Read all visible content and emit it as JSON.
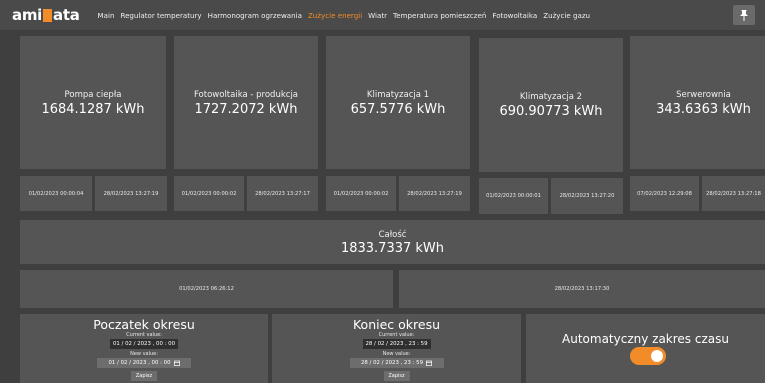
{
  "brand": {
    "logo_pre": "ami",
    "logo_post": "ata"
  },
  "nav": {
    "items": [
      {
        "label": "Main"
      },
      {
        "label": "Regulator temperatury"
      },
      {
        "label": "Harmonogram ogrzewania"
      },
      {
        "label": "Zużycie energii",
        "active": true
      },
      {
        "label": "Wiatr"
      },
      {
        "label": "Temperatura pomieszczeń"
      },
      {
        "label": "Fotowoltaika"
      },
      {
        "label": "Zużycie gazu"
      }
    ]
  },
  "cards": [
    {
      "title": "Pompa ciepła",
      "value": "1684.1287 kWh",
      "start": "01/02/2023 00:00:04",
      "end": "28/02/2023 13:27:19"
    },
    {
      "title": "Fotowoltaika - produkcja",
      "value": "1727.2072 kWh",
      "start": "01/02/2023 00:00:02",
      "end": "28/02/2023 13:27:17"
    },
    {
      "title": "Klimatyzacja 1",
      "value": "657.5776 kWh",
      "start": "01/02/2023 00:00:02",
      "end": "28/02/2023 13:27:19"
    },
    {
      "title": "Klimatyzacja 2",
      "value": "690.90773 kWh",
      "start": "01/02/2023 00:00:01",
      "end": "28/02/2023 13:27:20"
    },
    {
      "title": "Serwerownia",
      "value": "343.6363 kWh",
      "start": "07/02/2023 12:29:08",
      "end": "28/02/2023 13:27:18"
    }
  ],
  "total": {
    "title": "Całość",
    "value": "1833.7337 kWh",
    "start": "01/02/2023 06:26:12",
    "end": "28/02/2023 13:17:30"
  },
  "period_start": {
    "title": "Poczatek okresu",
    "current_label": "Current value:",
    "current_value": "01 / 02 / 2023 , 00 : 00",
    "new_label": "New value:",
    "new_value": "01 / 02 / 2023 , 00 : 00",
    "save_label": "Zapisz"
  },
  "period_end": {
    "title": "Koniec okresu",
    "current_label": "Current value:",
    "current_value": "28 / 02 / 2023 , 23 : 59",
    "new_label": "New value:",
    "new_value": "28 / 02 / 2023 , 23 : 59",
    "save_label": "Zapisz"
  },
  "auto_range": {
    "label": "Automatyczny zakres czasu",
    "enabled": true
  },
  "colors": {
    "accent": "#f28c28",
    "panel": "#555555",
    "background": "#3f3f3f",
    "topbar": "#4a4a4a"
  },
  "icons": {
    "pin": "pin-icon",
    "calendar": "calendar-icon"
  }
}
